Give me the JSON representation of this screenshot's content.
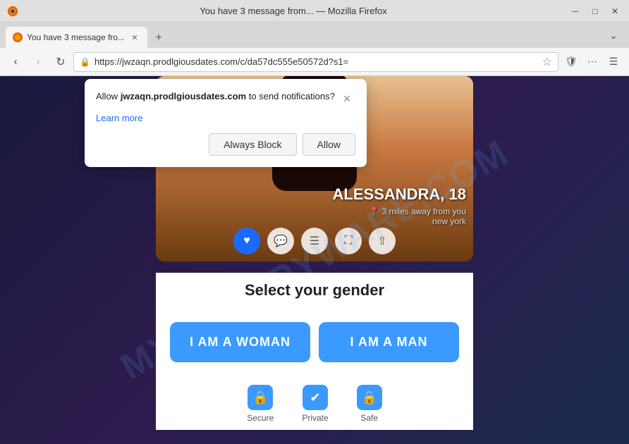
{
  "browser": {
    "title": "You have 3 message from... — Mozilla Firefox",
    "tab": {
      "label": "You have 3 message fro...",
      "favicon": "🦊"
    },
    "address": "https://jwzaqn.prodlgiousdates.com/c/da57dc555e50572d?s1=",
    "nav": {
      "back_disabled": false,
      "forward_disabled": true
    }
  },
  "notification_popup": {
    "title_part1": "Allow ",
    "domain": "jwzaqn.prodlgiousdates.com",
    "title_part2": " to send notifications?",
    "learn_more": "Learn more",
    "always_block_label": "Always Block",
    "allow_label": "Allow",
    "close_icon": "×"
  },
  "page": {
    "watermark": "MYANTISPYWARE.COM",
    "character": {
      "name": "ALESSANDRA, 18",
      "location": "3 miles away from you\nnew york",
      "heart_icon": "♡"
    },
    "actions": {
      "heart": "♥",
      "chat": "💬",
      "menu": "☰",
      "expand": "⛶",
      "share": "⇧"
    },
    "gender_section": {
      "title": "Select your gender",
      "woman_btn": "I AM A WOMAN",
      "man_btn": "I AM A MAN"
    },
    "trust_badges": [
      {
        "icon": "🔒",
        "label": "Secure"
      },
      {
        "icon": "✔",
        "label": "Private"
      },
      {
        "icon": "🔒",
        "label": "Safe"
      }
    ]
  }
}
